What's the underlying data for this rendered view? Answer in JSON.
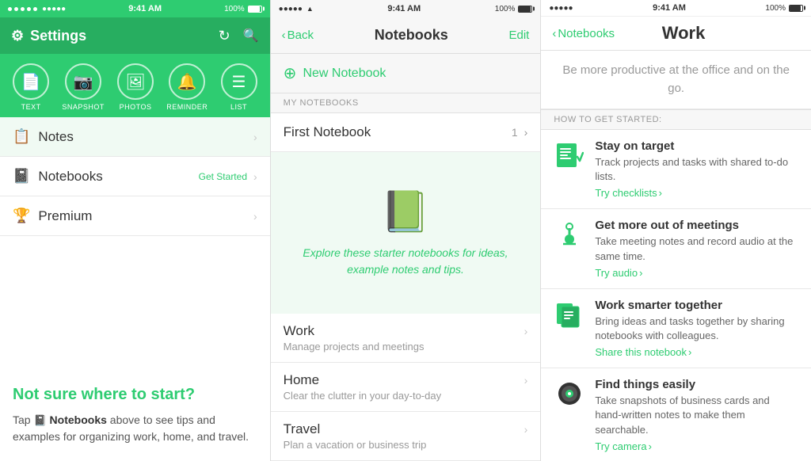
{
  "panel1": {
    "statusBar": {
      "time": "9:41 AM",
      "battery": "100%"
    },
    "header": {
      "title": "Settings",
      "refreshIcon": "↻",
      "searchIcon": "🔍"
    },
    "iconRow": [
      {
        "icon": "📄",
        "label": "TEXT"
      },
      {
        "icon": "📷",
        "label": "SNAPSHOT"
      },
      {
        "icon": "🖼",
        "label": "PHOTOS"
      },
      {
        "icon": "🔔",
        "label": "REMINDER"
      },
      {
        "icon": "☰",
        "label": "LIST"
      }
    ],
    "menuItems": [
      {
        "icon": "📋",
        "label": "Notes",
        "badge": "",
        "hasChevron": true
      },
      {
        "icon": "📓",
        "label": "Notebooks",
        "badge": "Get Started",
        "hasChevron": true
      },
      {
        "icon": "🏆",
        "label": "Premium",
        "badge": "",
        "hasChevron": true
      }
    ],
    "promo": {
      "title": "Not sure where to start?",
      "text": "Tap  Notebooks above to see tips and examples for organizing work, home, and travel.",
      "notebookIconLabel": "📓",
      "boldText": "Notebooks"
    }
  },
  "panel2": {
    "statusBar": {
      "time": "9:41 AM",
      "battery": "100%"
    },
    "header": {
      "backLabel": "Back",
      "title": "Notebooks",
      "editLabel": "Edit"
    },
    "newNotebook": {
      "label": "New Notebook"
    },
    "sectionLabel": "MY NOTEBOOKS",
    "myNotebooks": [
      {
        "name": "First Notebook",
        "count": "1"
      }
    ],
    "starterText": "Explore these starter notebooks for ideas, example notes and tips.",
    "starterNotebooks": [
      {
        "name": "Work",
        "sub": "Manage projects and meetings"
      },
      {
        "name": "Home",
        "sub": "Clear the clutter in your day-to-day"
      },
      {
        "name": "Travel",
        "sub": "Plan a vacation or business trip"
      }
    ]
  },
  "panel3": {
    "statusBar": {
      "time": "9:41 AM",
      "battery": "100%"
    },
    "header": {
      "backLabel": "Notebooks",
      "title": "Work"
    },
    "tagline": "Be more productive at the office and on the go.",
    "sectionLabel": "HOW TO GET STARTED:",
    "tips": [
      {
        "iconEmoji": "📋",
        "iconColor": "#2ecc71",
        "title": "Stay on target",
        "desc": "Track projects and tasks with shared to-do lists.",
        "linkText": "Try checklists",
        "linkIcon": "›"
      },
      {
        "iconEmoji": "🎤",
        "iconColor": "#2ecc71",
        "title": "Get more out of meetings",
        "desc": "Take meeting notes and record audio at the same time.",
        "linkText": "Try audio",
        "linkIcon": "›"
      },
      {
        "iconEmoji": "📗",
        "iconColor": "#2ecc71",
        "title": "Work smarter together",
        "desc": "Bring ideas and tasks together by sharing notebooks with colleagues.",
        "linkText": "Share this notebook",
        "linkIcon": "›"
      },
      {
        "iconEmoji": "📷",
        "iconColor": "#2ecc71",
        "title": "Find things easily",
        "desc": "Take snapshots of business cards and hand-written notes to make them searchable.",
        "linkText": "Try camera",
        "linkIcon": "›"
      }
    ]
  }
}
